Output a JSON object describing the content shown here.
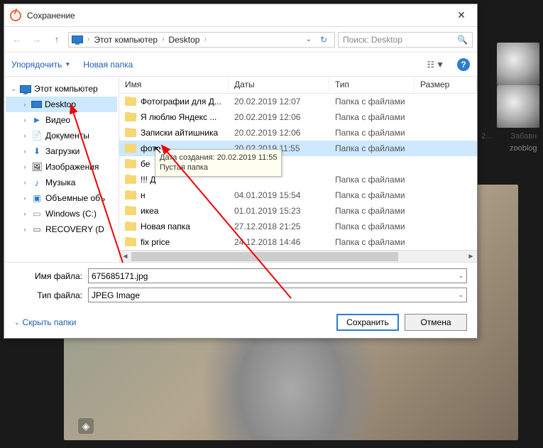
{
  "dialog": {
    "title": "Сохранение",
    "breadcrumb": [
      "Этот компьютер",
      "Desktop"
    ],
    "search_placeholder": "Поиск: Desktop",
    "organize": "Упорядочить",
    "new_folder": "Новая папка",
    "columns": {
      "name": "Имя",
      "date": "Даты",
      "type": "Тип",
      "size": "Размер"
    },
    "tree": {
      "root": "Этот компьютер",
      "items": [
        {
          "label": "Desktop",
          "selected": true,
          "icon": "i-desktop"
        },
        {
          "label": "Видео",
          "icon": "i-video"
        },
        {
          "label": "Документы",
          "icon": "i-docs"
        },
        {
          "label": "Загрузки",
          "icon": "i-down"
        },
        {
          "label": "Изображения",
          "icon": "i-img"
        },
        {
          "label": "Музыка",
          "icon": "i-music"
        },
        {
          "label": "Объемные объ",
          "icon": "i-3d"
        },
        {
          "label": "Windows (C:)",
          "icon": "i-disk"
        },
        {
          "label": "RECOVERY (D",
          "icon": "i-recov"
        }
      ]
    },
    "rows": [
      {
        "name": "Фотографии для Д...",
        "date": "20.02.2019 12:07",
        "type": "Папка с файлами"
      },
      {
        "name": "Я люблю Яндекс ...",
        "date": "20.02.2019 12:06",
        "type": "Папка с файлами"
      },
      {
        "name": "Записки айтишника",
        "date": "20.02.2019 12:06",
        "type": "Папка с файлами"
      },
      {
        "name": "фото",
        "date": "20.02.2019 11:55",
        "type": "Папка с файлами",
        "selected": true
      },
      {
        "name": "бе",
        "date": "",
        "type": ""
      },
      {
        "name": "!!! Д",
        "date": "",
        "type": "Папка с файлами"
      },
      {
        "name": "н",
        "date": "04.01.2019 15:54",
        "type": "Папка с файлами"
      },
      {
        "name": "икеа",
        "date": "01.01.2019 15:23",
        "type": "Папка с файлами"
      },
      {
        "name": "Новая папка",
        "date": "27.12.2018 21:25",
        "type": "Папка с файлами"
      },
      {
        "name": "fix price",
        "date": "24.12.2018 14:46",
        "type": "Папка с файлами"
      }
    ],
    "tooltip": {
      "line1": "Дата создания: 20.02.2019 11:55",
      "line2": "Пустая папка"
    },
    "filename_label": "Имя файла:",
    "filename_value": "675685171.jpg",
    "filetype_label": "Тип файла:",
    "filetype_value": "JPEG Image",
    "hide_folders": "Скрыть папки",
    "save": "Сохранить",
    "cancel": "Отмена"
  },
  "thumbs": {
    "caption1": "2...",
    "caption2": "Забавн",
    "caption3": "zooblog"
  }
}
